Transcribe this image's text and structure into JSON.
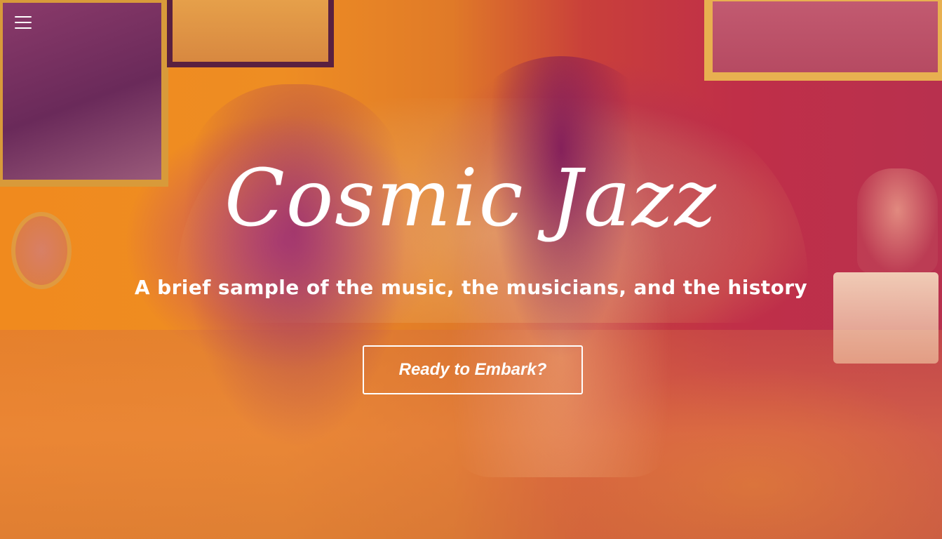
{
  "menu": {
    "icon": "hamburger-menu-icon"
  },
  "hero": {
    "title": "Cosmic Jazz",
    "subtitle": "A brief sample of the music, the musicians, and the history",
    "cta_label": "Ready to Embark?",
    "overlay_colors": {
      "orange": "#f08a1e",
      "magenta": "#b8304e",
      "purple": "#9a2a8a"
    }
  }
}
